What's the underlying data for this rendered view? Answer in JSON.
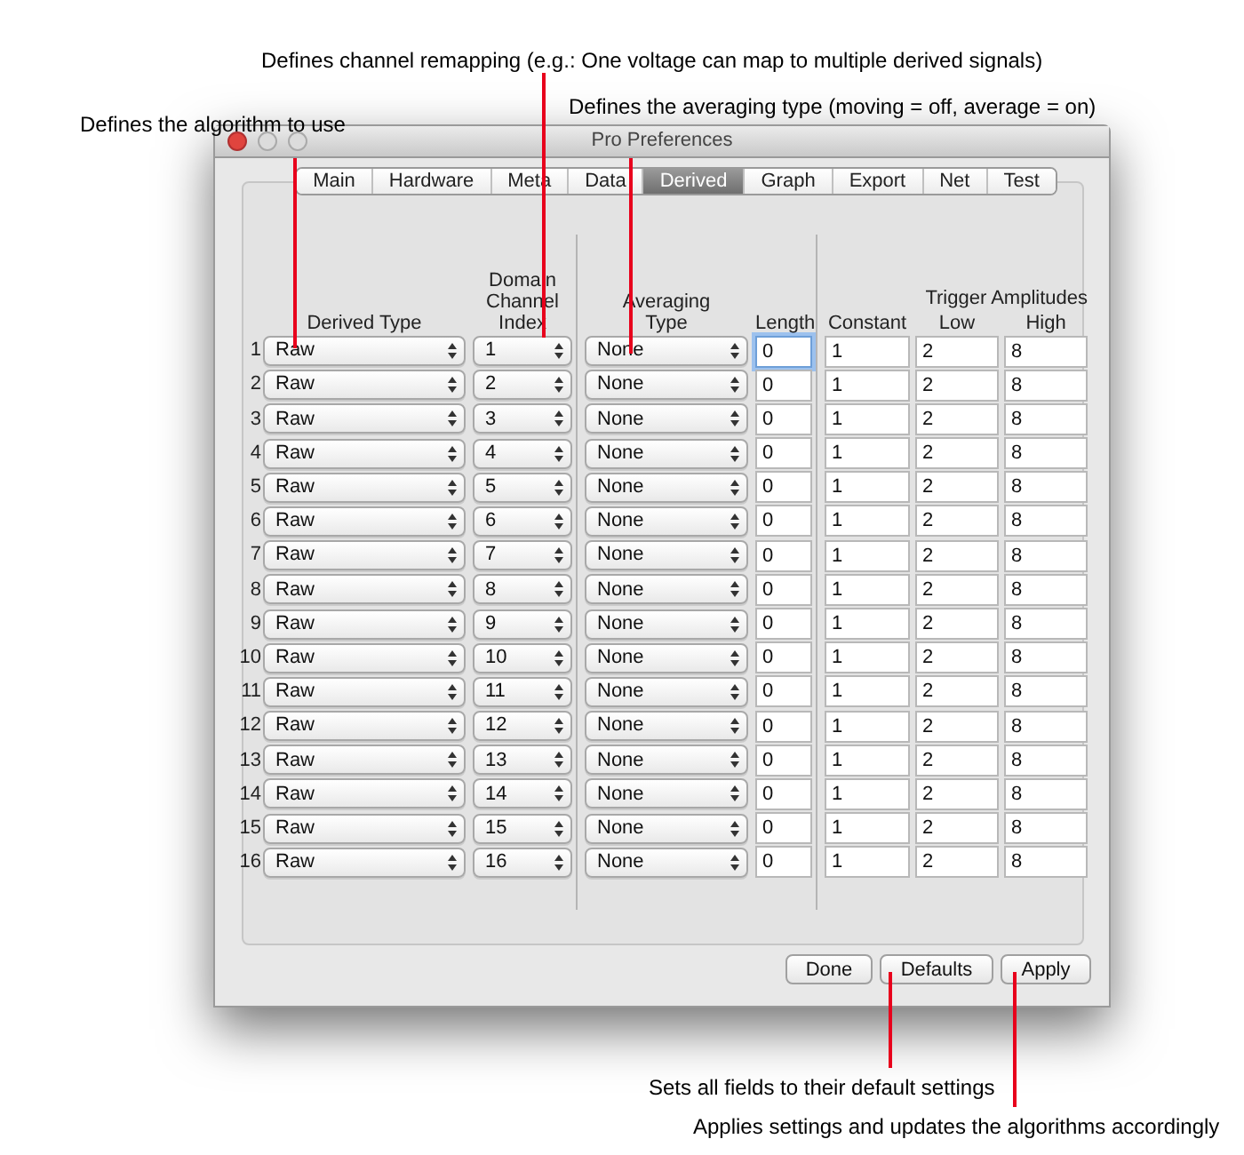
{
  "annotations": [
    {
      "text": "Defines channel remapping (e.g.: One voltage can map to multiple derived signals)"
    },
    {
      "text": "Defines the averaging type (moving = off, average = on)"
    },
    {
      "text": "Defines the algorithm to use"
    },
    {
      "text": "Sets all fields to their default settings"
    },
    {
      "text": "Applies settings and updates the algorithms accordingly"
    }
  ],
  "window": {
    "title": "Pro Preferences"
  },
  "tabs": [
    {
      "label": "Main",
      "selected": false
    },
    {
      "label": "Hardware",
      "selected": false
    },
    {
      "label": "Meta",
      "selected": false
    },
    {
      "label": "Data",
      "selected": false
    },
    {
      "label": "Derived",
      "selected": true
    },
    {
      "label": "Graph",
      "selected": false
    },
    {
      "label": "Export",
      "selected": false
    },
    {
      "label": "Net",
      "selected": false
    },
    {
      "label": "Test",
      "selected": false
    }
  ],
  "table": {
    "header": {
      "derived_type": "Derived Type",
      "domain_channel_index": "Domain Channel Index",
      "averaging_type": "Averaging Type",
      "length": "Length",
      "trigger_amplitudes": "Trigger Amplitudes",
      "constant": "Constant",
      "low": "Low",
      "high": "High"
    },
    "rows": [
      {
        "number": "1",
        "derived_type": "Raw",
        "index": "1",
        "averaging_type": "None",
        "length": "0",
        "focused": true,
        "constant": "1",
        "low": "2",
        "high": "8"
      },
      {
        "number": "2",
        "derived_type": "Raw",
        "index": "2",
        "averaging_type": "None",
        "length": "0",
        "focused": false,
        "constant": "1",
        "low": "2",
        "high": "8"
      },
      {
        "number": "3",
        "derived_type": "Raw",
        "index": "3",
        "averaging_type": "None",
        "length": "0",
        "focused": false,
        "constant": "1",
        "low": "2",
        "high": "8"
      },
      {
        "number": "4",
        "derived_type": "Raw",
        "index": "4",
        "averaging_type": "None",
        "length": "0",
        "focused": false,
        "constant": "1",
        "low": "2",
        "high": "8"
      },
      {
        "number": "5",
        "derived_type": "Raw",
        "index": "5",
        "averaging_type": "None",
        "length": "0",
        "focused": false,
        "constant": "1",
        "low": "2",
        "high": "8"
      },
      {
        "number": "6",
        "derived_type": "Raw",
        "index": "6",
        "averaging_type": "None",
        "length": "0",
        "focused": false,
        "constant": "1",
        "low": "2",
        "high": "8"
      },
      {
        "number": "7",
        "derived_type": "Raw",
        "index": "7",
        "averaging_type": "None",
        "length": "0",
        "focused": false,
        "constant": "1",
        "low": "2",
        "high": "8"
      },
      {
        "number": "8",
        "derived_type": "Raw",
        "index": "8",
        "averaging_type": "None",
        "length": "0",
        "focused": false,
        "constant": "1",
        "low": "2",
        "high": "8"
      },
      {
        "number": "9",
        "derived_type": "Raw",
        "index": "9",
        "averaging_type": "None",
        "length": "0",
        "focused": false,
        "constant": "1",
        "low": "2",
        "high": "8"
      },
      {
        "number": "10",
        "derived_type": "Raw",
        "index": "10",
        "averaging_type": "None",
        "length": "0",
        "focused": false,
        "constant": "1",
        "low": "2",
        "high": "8"
      },
      {
        "number": "11",
        "derived_type": "Raw",
        "index": "11",
        "averaging_type": "None",
        "length": "0",
        "focused": false,
        "constant": "1",
        "low": "2",
        "high": "8"
      },
      {
        "number": "12",
        "derived_type": "Raw",
        "index": "12",
        "averaging_type": "None",
        "length": "0",
        "focused": false,
        "constant": "1",
        "low": "2",
        "high": "8"
      },
      {
        "number": "13",
        "derived_type": "Raw",
        "index": "13",
        "averaging_type": "None",
        "length": "0",
        "focused": false,
        "constant": "1",
        "low": "2",
        "high": "8"
      },
      {
        "number": "14",
        "derived_type": "Raw",
        "index": "14",
        "averaging_type": "None",
        "length": "0",
        "focused": false,
        "constant": "1",
        "low": "2",
        "high": "8"
      },
      {
        "number": "15",
        "derived_type": "Raw",
        "index": "15",
        "averaging_type": "None",
        "length": "0",
        "focused": false,
        "constant": "1",
        "low": "2",
        "high": "8"
      },
      {
        "number": "16",
        "derived_type": "Raw",
        "index": "16",
        "averaging_type": "None",
        "length": "0",
        "focused": false,
        "constant": "1",
        "low": "2",
        "high": "8"
      }
    ]
  },
  "buttons": [
    "Done",
    "Defaults",
    "Apply"
  ]
}
